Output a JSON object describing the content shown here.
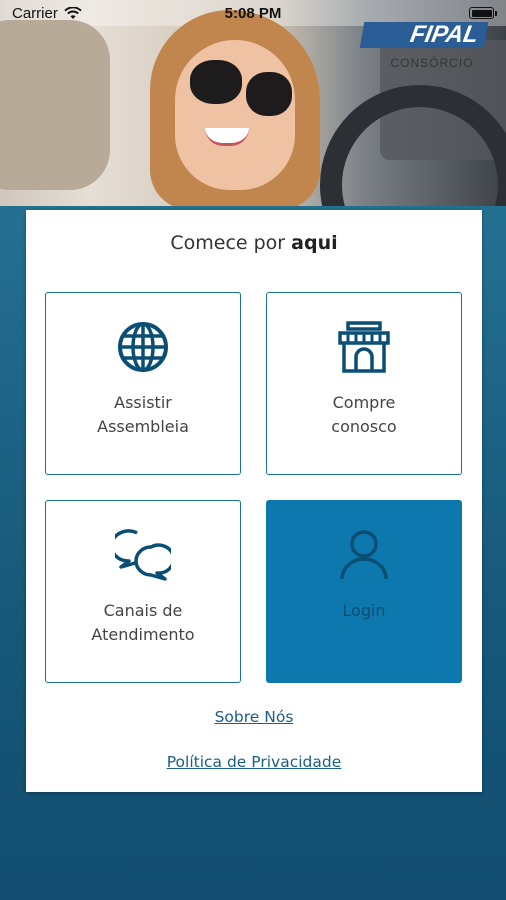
{
  "status_bar": {
    "carrier": "Carrier",
    "time": "5:08 PM"
  },
  "brand": {
    "logo_text": "FIPAL",
    "logo_sub": "CONSÓRCIO",
    "color": "#2a5d95"
  },
  "card": {
    "title_prefix": "Comece por ",
    "title_emphasis": "aqui",
    "tiles": [
      {
        "label": "Assistir\nAssembleia",
        "icon": "globe-icon"
      },
      {
        "label": "Compre\nconosco",
        "icon": "store-icon"
      },
      {
        "label": "Canais de\nAtendimento",
        "icon": "chat-bubbles-icon"
      },
      {
        "label": "Login",
        "icon": "user-icon"
      }
    ],
    "links": {
      "about": "Sobre Nós",
      "privacy": "Política de Privacidade"
    }
  },
  "colors": {
    "accent": "#0d78ad",
    "icon": "#0a4f73",
    "text": "#444444"
  }
}
